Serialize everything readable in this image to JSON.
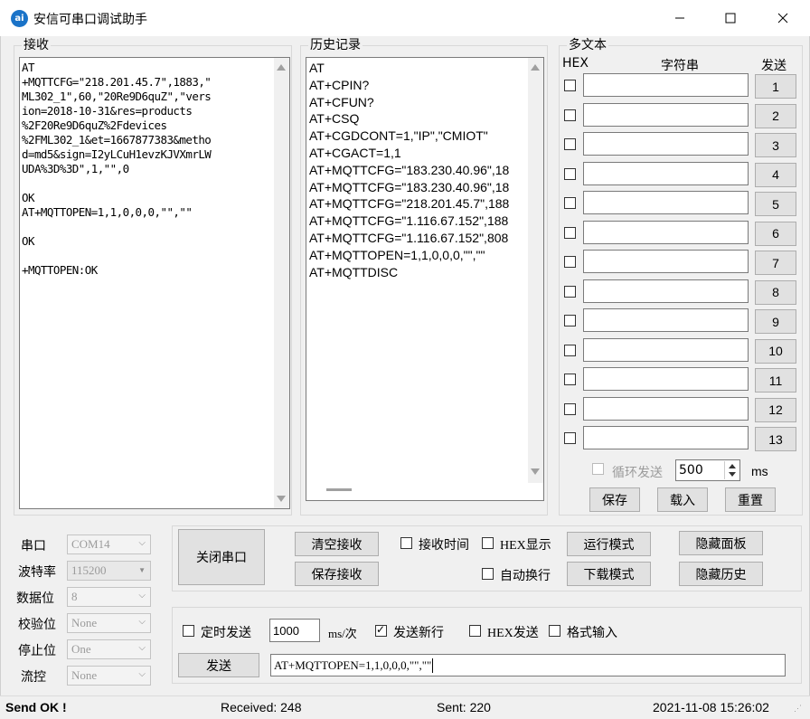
{
  "window": {
    "title": "安信可串口调试助手",
    "icon_text": "ai",
    "accent": "#1a73c8"
  },
  "receive": {
    "legend": "接收",
    "text": "AT\n+MQTTCFG=\"218.201.45.7\",1883,\"\nML302_1\",60,\"20Re9D6quZ\",\"vers\nion=2018-10-31&res=products\n%2F20Re9D6quZ%2Fdevices\n%2FML302_1&et=1667877383&metho\nd=md5&sign=I2yLCuH1evzKJVXmrLW\nUDA%3D%3D\",1,\"\",0\n\nOK\nAT+MQTTOPEN=1,1,0,0,0,\"\",\"\"\n\nOK\n\n+MQTTOPEN:OK"
  },
  "history": {
    "legend": "历史记录",
    "items": [
      "AT",
      "AT+CPIN?",
      "AT+CFUN?",
      "AT+CSQ",
      "AT+CGDCONT=1,\"IP\",\"CMIOT\"",
      "AT+CGACT=1,1",
      "AT+MQTTCFG=\"183.230.40.96\",18",
      "AT+MQTTCFG=\"183.230.40.96\",18",
      "AT+MQTTCFG=\"218.201.45.7\",188",
      "AT+MQTTCFG=\"1.116.67.152\",188",
      "AT+MQTTCFG=\"1.116.67.152\",808",
      "AT+MQTTOPEN=1,1,0,0,0,\"\",\"\"",
      "AT+MQTTDISC"
    ]
  },
  "multitext": {
    "legend": "多文本",
    "col_hex": "HEX",
    "col_string": "字符串",
    "col_send": "发送",
    "rows": [
      "1",
      "2",
      "3",
      "4",
      "5",
      "6",
      "7",
      "8",
      "9",
      "10",
      "11",
      "12",
      "13"
    ],
    "loop_label": "循环发送",
    "loop_interval": "500",
    "loop_unit": "ms",
    "save": "保存",
    "load": "载入",
    "reset": "重置"
  },
  "port": {
    "port_label": "串口",
    "port_value": "COM14",
    "baud_label": "波特率",
    "baud_value": "115200",
    "databits_label": "数据位",
    "databits_value": "8",
    "parity_label": "校验位",
    "parity_value": "None",
    "stopbits_label": "停止位",
    "stopbits_value": "One",
    "flow_label": "流控",
    "flow_value": "None"
  },
  "controls": {
    "close_port": "关闭串口",
    "clear_recv": "清空接收",
    "save_recv": "保存接收",
    "recv_time": "接收时间",
    "hex_display": "HEX显示",
    "auto_wrap": "自动换行",
    "run_mode": "运行模式",
    "download_mode": "下载模式",
    "hide_panel": "隐藏面板",
    "hide_history": "隐藏历史"
  },
  "send": {
    "timed_send": "定时发送",
    "interval": "1000",
    "interval_unit": "ms/次",
    "send_newline": "发送新行",
    "hex_send": "HEX发送",
    "format_input": "格式输入",
    "send_button": "发送",
    "input_value": "AT+MQTTOPEN=1,1,0,0,0,\"\",\"\""
  },
  "status": {
    "message": "Send OK !",
    "received": "Received: 248",
    "sent": "Sent: 220",
    "datetime": "2021-11-08 15:26:02"
  }
}
